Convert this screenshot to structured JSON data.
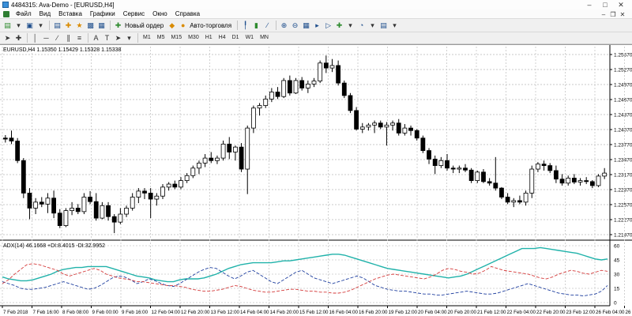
{
  "window": {
    "title": "4484315: Ava-Demo - [EURUSD,H4]"
  },
  "menu": {
    "items": [
      "Файл",
      "Вид",
      "Вставка",
      "Графики",
      "Сервис",
      "Окно",
      "Справка"
    ]
  },
  "toolbar": {
    "new_order_label": "Новый ордер",
    "auto_trading_label": "Авто-торговля"
  },
  "drawing_toolbar": {
    "text_tool": "A",
    "label_tool": "T"
  },
  "timeframes": [
    "M1",
    "M5",
    "M15",
    "M30",
    "H1",
    "H4",
    "D1",
    "W1",
    "MN"
  ],
  "chart": {
    "header": "EURUSD,H4  1.15350 1.15429 1.15328 1.15338",
    "indicator_header": "ADX(14) 46.1668 +DI:8.4015 -DI:32.9952",
    "price_ticks": [
      "1.25570",
      "1.25270",
      "1.24970",
      "1.24670",
      "1.24370",
      "1.24070",
      "1.23770",
      "1.23470",
      "1.23170",
      "1.22870",
      "1.22570",
      "1.22270",
      "1.21970"
    ],
    "indicator_ticks": [
      "60",
      "45",
      "30",
      "15",
      "0"
    ],
    "time_ticks": [
      "7 Feb 2018",
      "7 Feb 16:00",
      "8 Feb 08:00",
      "9 Feb 00:00",
      "9 Feb 16:00",
      "12 Feb 04:00",
      "12 Feb 20:00",
      "13 Feb 12:00",
      "14 Feb 04:00",
      "14 Feb 20:00",
      "15 Feb 12:00",
      "16 Feb 04:00",
      "16 Feb 20:00",
      "19 Feb 12:00",
      "20 Feb 04:00",
      "20 Feb 20:00",
      "21 Feb 12:00",
      "22 Feb 04:00",
      "22 Feb 20:00",
      "23 Feb 12:00",
      "26 Feb 04:00",
      "26 Feb 20:00"
    ],
    "colors": {
      "adx": "#20b2aa",
      "plus_di": "#1f3f9f",
      "minus_di": "#d43a3a",
      "bull_body": "#ffffff",
      "bear_body": "#000000"
    }
  },
  "chart_data": {
    "type": "candlestick",
    "symbol": "EURUSD",
    "timeframe": "H4",
    "price_range": [
      1.2197,
      1.2557
    ],
    "candles": [
      [
        1.239,
        1.2396,
        1.2381,
        1.2388
      ],
      [
        1.239,
        1.2405,
        1.2378,
        1.2384
      ],
      [
        1.2384,
        1.239,
        1.234,
        1.2345
      ],
      [
        1.2345,
        1.235,
        1.227,
        1.228
      ],
      [
        1.228,
        1.229,
        1.2228,
        1.225
      ],
      [
        1.225,
        1.227,
        1.2238,
        1.2262
      ],
      [
        1.2262,
        1.2272,
        1.2252,
        1.2258
      ],
      [
        1.2258,
        1.228,
        1.224,
        1.227
      ],
      [
        1.227,
        1.2285,
        1.223,
        1.224
      ],
      [
        1.224,
        1.2248,
        1.221,
        1.2215
      ],
      [
        1.2215,
        1.225,
        1.2212,
        1.2245
      ],
      [
        1.2245,
        1.2262,
        1.2236,
        1.225
      ],
      [
        1.225,
        1.2258,
        1.2238,
        1.2243
      ],
      [
        1.2243,
        1.228,
        1.2238,
        1.2272
      ],
      [
        1.2272,
        1.2284,
        1.2258,
        1.2263
      ],
      [
        1.2263,
        1.228,
        1.2225,
        1.223
      ],
      [
        1.223,
        1.2262,
        1.2228,
        1.2255
      ],
      [
        1.2255,
        1.2262,
        1.2225,
        1.2233
      ],
      [
        1.2233,
        1.2238,
        1.22,
        1.2222
      ],
      [
        1.2222,
        1.225,
        1.2218,
        1.2238
      ],
      [
        1.2238,
        1.2255,
        1.2232,
        1.225
      ],
      [
        1.225,
        1.228,
        1.2245,
        1.2272
      ],
      [
        1.2272,
        1.229,
        1.226,
        1.2284
      ],
      [
        1.2284,
        1.229,
        1.2268,
        1.228
      ],
      [
        1.228,
        1.229,
        1.223,
        1.2268
      ],
      [
        1.2268,
        1.228,
        1.2255,
        1.2274
      ],
      [
        1.2274,
        1.2298,
        1.2268,
        1.2292
      ],
      [
        1.2292,
        1.2302,
        1.2285,
        1.2298
      ],
      [
        1.2298,
        1.2305,
        1.2288,
        1.2292
      ],
      [
        1.2292,
        1.2312,
        1.2288,
        1.2305
      ],
      [
        1.2305,
        1.232,
        1.23,
        1.2315
      ],
      [
        1.2315,
        1.2335,
        1.231,
        1.233
      ],
      [
        1.233,
        1.2345,
        1.2318,
        1.234
      ],
      [
        1.234,
        1.2358,
        1.2332,
        1.235
      ],
      [
        1.235,
        1.2362,
        1.234,
        1.2345
      ],
      [
        1.2345,
        1.2355,
        1.2338,
        1.235
      ],
      [
        1.235,
        1.2385,
        1.2345,
        1.2378
      ],
      [
        1.2378,
        1.2392,
        1.2348,
        1.2362
      ],
      [
        1.2362,
        1.2375,
        1.2345,
        1.2372
      ],
      [
        1.2372,
        1.238,
        1.2322,
        1.2328
      ],
      [
        1.2328,
        1.2415,
        1.2278,
        1.241
      ],
      [
        1.241,
        1.2455,
        1.24,
        1.245
      ],
      [
        1.245,
        1.246,
        1.2435,
        1.2455
      ],
      [
        1.2455,
        1.2475,
        1.245,
        1.2468
      ],
      [
        1.2468,
        1.249,
        1.2462,
        1.2482
      ],
      [
        1.2482,
        1.2492,
        1.2468,
        1.2473
      ],
      [
        1.2473,
        1.251,
        1.247,
        1.2505
      ],
      [
        1.2505,
        1.2515,
        1.2475,
        1.248
      ],
      [
        1.248,
        1.251,
        1.2478,
        1.2505
      ],
      [
        1.2505,
        1.2512,
        1.2485,
        1.249
      ],
      [
        1.249,
        1.2505,
        1.248,
        1.2498
      ],
      [
        1.2498,
        1.251,
        1.2492,
        1.2504
      ],
      [
        1.2504,
        1.2545,
        1.25,
        1.254
      ],
      [
        1.254,
        1.2555,
        1.252,
        1.253
      ],
      [
        1.253,
        1.2548,
        1.2522,
        1.2535
      ],
      [
        1.2535,
        1.2545,
        1.2495,
        1.25
      ],
      [
        1.25,
        1.2505,
        1.247,
        1.2475
      ],
      [
        1.2475,
        1.248,
        1.244,
        1.2445
      ],
      [
        1.2445,
        1.2452,
        1.2405,
        1.2408
      ],
      [
        1.2408,
        1.242,
        1.24,
        1.2412
      ],
      [
        1.2412,
        1.242,
        1.2405,
        1.2416
      ],
      [
        1.2416,
        1.2425,
        1.24,
        1.242
      ],
      [
        1.242,
        1.2425,
        1.2408,
        1.2412
      ],
      [
        1.2412,
        1.2422,
        1.2375,
        1.2416
      ],
      [
        1.2416,
        1.2425,
        1.2405,
        1.242
      ],
      [
        1.242,
        1.2428,
        1.2395,
        1.24
      ],
      [
        1.24,
        1.2418,
        1.2395,
        1.241
      ],
      [
        1.241,
        1.2415,
        1.2395,
        1.2405
      ],
      [
        1.2405,
        1.2408,
        1.2385,
        1.239
      ],
      [
        1.239,
        1.2395,
        1.236,
        1.2365
      ],
      [
        1.2365,
        1.237,
        1.2338,
        1.2348
      ],
      [
        1.2348,
        1.2355,
        1.2318,
        1.2335
      ],
      [
        1.2335,
        1.2352,
        1.233,
        1.2345
      ],
      [
        1.2345,
        1.2358,
        1.2325,
        1.233
      ],
      [
        1.233,
        1.2335,
        1.232,
        1.2328
      ],
      [
        1.2328,
        1.2335,
        1.232,
        1.233
      ],
      [
        1.233,
        1.2338,
        1.2322,
        1.2326
      ],
      [
        1.2326,
        1.233,
        1.23,
        1.2305
      ],
      [
        1.2305,
        1.2325,
        1.23,
        1.2322
      ],
      [
        1.2322,
        1.2328,
        1.23,
        1.2303
      ],
      [
        1.2303,
        1.231,
        1.2295,
        1.23
      ],
      [
        1.23,
        1.2352,
        1.2285,
        1.229
      ],
      [
        1.229,
        1.2292,
        1.2268,
        1.2272
      ],
      [
        1.2272,
        1.228,
        1.2258,
        1.2262
      ],
      [
        1.2262,
        1.227,
        1.2252,
        1.2265
      ],
      [
        1.2265,
        1.2275,
        1.2258,
        1.2262
      ],
      [
        1.2262,
        1.2285,
        1.2255,
        1.228
      ],
      [
        1.228,
        1.2335,
        1.227,
        1.2328
      ],
      [
        1.2328,
        1.2342,
        1.2322,
        1.2338
      ],
      [
        1.2338,
        1.2345,
        1.2325,
        1.2335
      ],
      [
        1.2335,
        1.234,
        1.232,
        1.2325
      ],
      [
        1.2325,
        1.2335,
        1.23,
        1.2308
      ],
      [
        1.2308,
        1.2318,
        1.2295,
        1.23
      ],
      [
        1.23,
        1.2315,
        1.2295,
        1.231
      ],
      [
        1.231,
        1.2318,
        1.2298,
        1.2302
      ],
      [
        1.2302,
        1.231,
        1.2295,
        1.2305
      ],
      [
        1.2305,
        1.2312,
        1.2298,
        1.2303
      ],
      [
        1.2303,
        1.2306,
        1.229,
        1.2295
      ],
      [
        1.2295,
        1.2318,
        1.2292,
        1.2314
      ],
      [
        1.2314,
        1.233,
        1.2308,
        1.232
      ]
    ],
    "indicator": {
      "name": "ADX(14)",
      "ylim": [
        0,
        60
      ],
      "series": [
        {
          "name": "ADX",
          "values": [
            27,
            25,
            24,
            23,
            23,
            24,
            26,
            28,
            30,
            33,
            35,
            36,
            37,
            37,
            38,
            38,
            38,
            38,
            36,
            34,
            32,
            30,
            28,
            27,
            26,
            24,
            23,
            22,
            22,
            24,
            25,
            25,
            25,
            26,
            28,
            30,
            33,
            36,
            38,
            40,
            41,
            42,
            42,
            42,
            42,
            43,
            44,
            44,
            45,
            46,
            47,
            48,
            49,
            50,
            51,
            51,
            50,
            48,
            46,
            44,
            42,
            40,
            38,
            36,
            35,
            34,
            33,
            32,
            31,
            30,
            29,
            28,
            27,
            26,
            27,
            28,
            30,
            33,
            36,
            39,
            42,
            45,
            48,
            51,
            54,
            57,
            57,
            57,
            58,
            57,
            56,
            55,
            54,
            53,
            52,
            50,
            48,
            46,
            45,
            46
          ]
        },
        {
          "name": "+DI",
          "values": [
            22,
            20,
            18,
            15,
            14,
            14,
            15,
            16,
            18,
            20,
            22,
            20,
            18,
            16,
            14,
            15,
            18,
            22,
            26,
            28,
            27,
            24,
            20,
            22,
            25,
            23,
            20,
            18,
            17,
            20,
            24,
            28,
            32,
            35,
            37,
            36,
            32,
            28,
            25,
            28,
            32,
            34,
            30,
            26,
            22,
            20,
            24,
            28,
            32,
            34,
            30,
            26,
            24,
            22,
            20,
            22,
            24,
            26,
            28,
            26,
            22,
            18,
            16,
            14,
            13,
            12,
            12,
            11,
            10,
            9,
            9,
            8,
            8,
            9,
            10,
            11,
            12,
            11,
            10,
            9,
            9,
            10,
            12,
            14,
            16,
            18,
            20,
            18,
            16,
            14,
            12,
            10,
            9,
            8,
            8,
            7,
            8,
            9,
            12,
            18
          ]
        },
        {
          "name": "-DI",
          "values": [
            20,
            24,
            30,
            35,
            40,
            41,
            40,
            38,
            36,
            34,
            30,
            28,
            30,
            32,
            34,
            36,
            34,
            30,
            28,
            26,
            25,
            24,
            22,
            22,
            21,
            20,
            19,
            18,
            18,
            17,
            16,
            14,
            13,
            12,
            12,
            13,
            14,
            16,
            18,
            17,
            15,
            13,
            12,
            11,
            11,
            12,
            13,
            14,
            14,
            13,
            12,
            12,
            11,
            11,
            10,
            10,
            11,
            13,
            16,
            19,
            22,
            25,
            27,
            29,
            30,
            29,
            28,
            27,
            26,
            25,
            27,
            30,
            34,
            36,
            35,
            33,
            32,
            30,
            31,
            34,
            38,
            36,
            34,
            33,
            32,
            31,
            30,
            28,
            26,
            25,
            27,
            30,
            32,
            34,
            33,
            31,
            30,
            32,
            34,
            33
          ]
        }
      ]
    }
  }
}
